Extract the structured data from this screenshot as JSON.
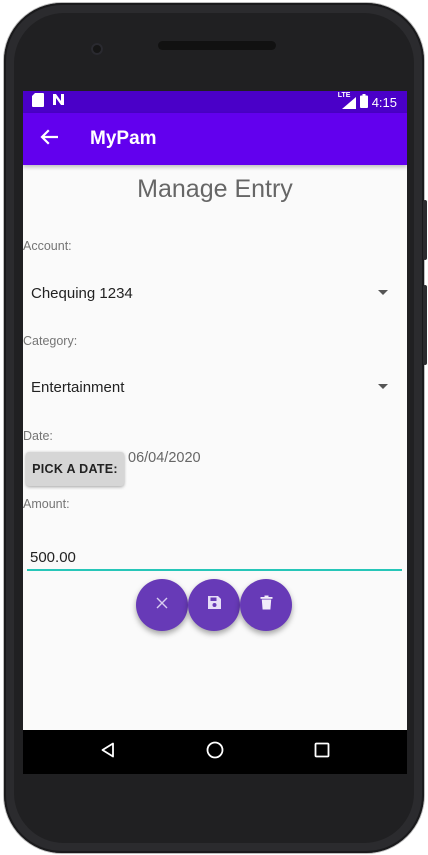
{
  "status_bar": {
    "time": "4:15",
    "network_label": "LTE",
    "icons": [
      "sd-card-icon",
      "n-notification-icon",
      "signal-icon",
      "battery-icon"
    ]
  },
  "app_bar": {
    "title": "MyPam",
    "back_icon": "arrow-back-icon"
  },
  "form": {
    "heading": "Manage Entry",
    "account_label": "Account:",
    "account_value": "Chequing 1234",
    "category_label": "Category:",
    "category_value": "Entertainment",
    "date_label": "Date:",
    "pick_date_button": "PICK A DATE:",
    "date_value": "06/04/2020",
    "amount_label": "Amount:",
    "amount_value": "500.00"
  },
  "actions": [
    {
      "name": "cancel",
      "icon": "close-icon"
    },
    {
      "name": "save",
      "icon": "save-icon"
    },
    {
      "name": "delete",
      "icon": "trash-icon"
    }
  ],
  "colors": {
    "status_bar": "#4a00c8",
    "app_bar": "#6200ee",
    "fab": "#673ab7",
    "input_underline": "#26c6b8"
  }
}
